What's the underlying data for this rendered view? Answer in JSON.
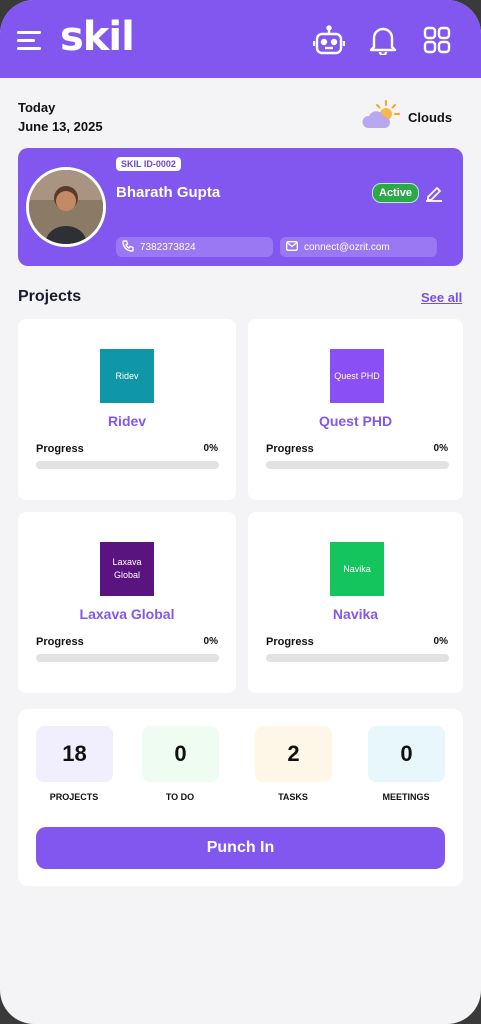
{
  "app": {
    "logo": "skil",
    "brand_color": "#8257f0"
  },
  "header": {
    "icons": [
      "hamburger-menu-icon",
      "robot-icon",
      "bell-icon",
      "grid-icon"
    ]
  },
  "date": {
    "label": "Today",
    "value": "June 13, 2025"
  },
  "weather": {
    "label": "Clouds",
    "icon": "partly-cloudy-icon"
  },
  "profile": {
    "skil_id": "SKIL ID-0002",
    "name": "Bharath Gupta",
    "status": "Active",
    "phone": "7382373824",
    "email": "connect@ozrit.com"
  },
  "projects_section": {
    "title": "Projects",
    "see_all": "See all"
  },
  "projects": [
    {
      "logo_text": "Ridev",
      "name": "Ridev",
      "logo_color": "#0f97a8",
      "progress_label": "Progress",
      "progress_text": "0%",
      "progress": 0
    },
    {
      "logo_text": "Quest PHD",
      "name": "Quest PHD",
      "logo_color": "#8a4ff5",
      "progress_label": "Progress",
      "progress_text": "0%",
      "progress": 0
    },
    {
      "logo_text": "Laxava Global",
      "name": "Laxava Global",
      "logo_color": "#5a1480",
      "progress_label": "Progress",
      "progress_text": "0%",
      "progress": 0
    },
    {
      "logo_text": "Navika",
      "name": "Navika",
      "logo_color": "#14c45c",
      "progress_label": "Progress",
      "progress_text": "0%",
      "progress": 0
    }
  ],
  "stats": [
    {
      "value": "18",
      "label": "PROJECTS",
      "bg": "#f1eefe"
    },
    {
      "value": "0",
      "label": "TO DO",
      "bg": "#eefcf2"
    },
    {
      "value": "2",
      "label": "TASKS",
      "bg": "#fef6e6"
    },
    {
      "value": "0",
      "label": "MEETINGS",
      "bg": "#e8f7fb"
    }
  ],
  "punch_button": "Punch In"
}
